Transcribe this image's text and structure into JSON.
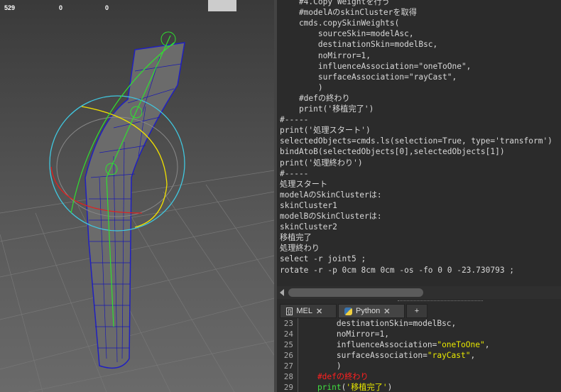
{
  "viewport": {
    "hud": [
      "529",
      "0",
      "0"
    ]
  },
  "output_lines": [
    "    #4.Copy Weightを行う",
    "    #modelAのskinClusterを取得",
    "    cmds.copySkinWeights(",
    "        sourceSkin=modelAsc,",
    "        destinationSkin=modelBsc,",
    "        noMirror=1,",
    "        influenceAssociation=\"oneToOne\",",
    "        surfaceAssociation=\"rayCast\",",
    "        )",
    "    #defの終わり",
    "    print('移植完了')",
    "#-----",
    "print('処理スタート')",
    "selectedObjects=cmds.ls(selection=True, type='transform')",
    "bindAtoB(selectedObjects[0],selectedObjects[1])",
    "print('処理終わり')",
    "#-----",
    "処理スタート",
    "modelAのSkinClusterは:",
    "skinCluster1",
    "modelBのSkinClusterは:",
    "skinCluster2",
    "移植完了",
    "処理終わり",
    "select -r joint5 ;",
    "rotate -r -p 0cm 8cm 0cm -os -fo 0 0 -23.730793 ;"
  ],
  "tabs": {
    "mel": "MEL",
    "python": "Python",
    "add": "+",
    "close": "✕"
  },
  "input": {
    "line_numbers": [
      "23",
      "24",
      "25",
      "26",
      "27",
      "28",
      "29"
    ],
    "l23": "        destinationSkin=modelBsc,",
    "l24": "        noMirror=1,",
    "l25a": "        influenceAssociation=",
    "l25b": "\"oneToOne\"",
    "l25c": ",",
    "l26a": "        surfaceAssociation=",
    "l26b": "\"rayCast\"",
    "l26c": ",",
    "l27": "        )",
    "l28": "    #defの終わり",
    "l29a": "    print",
    "l29b": "(",
    "l29c": "'移植完了'",
    "l29d": ")"
  }
}
